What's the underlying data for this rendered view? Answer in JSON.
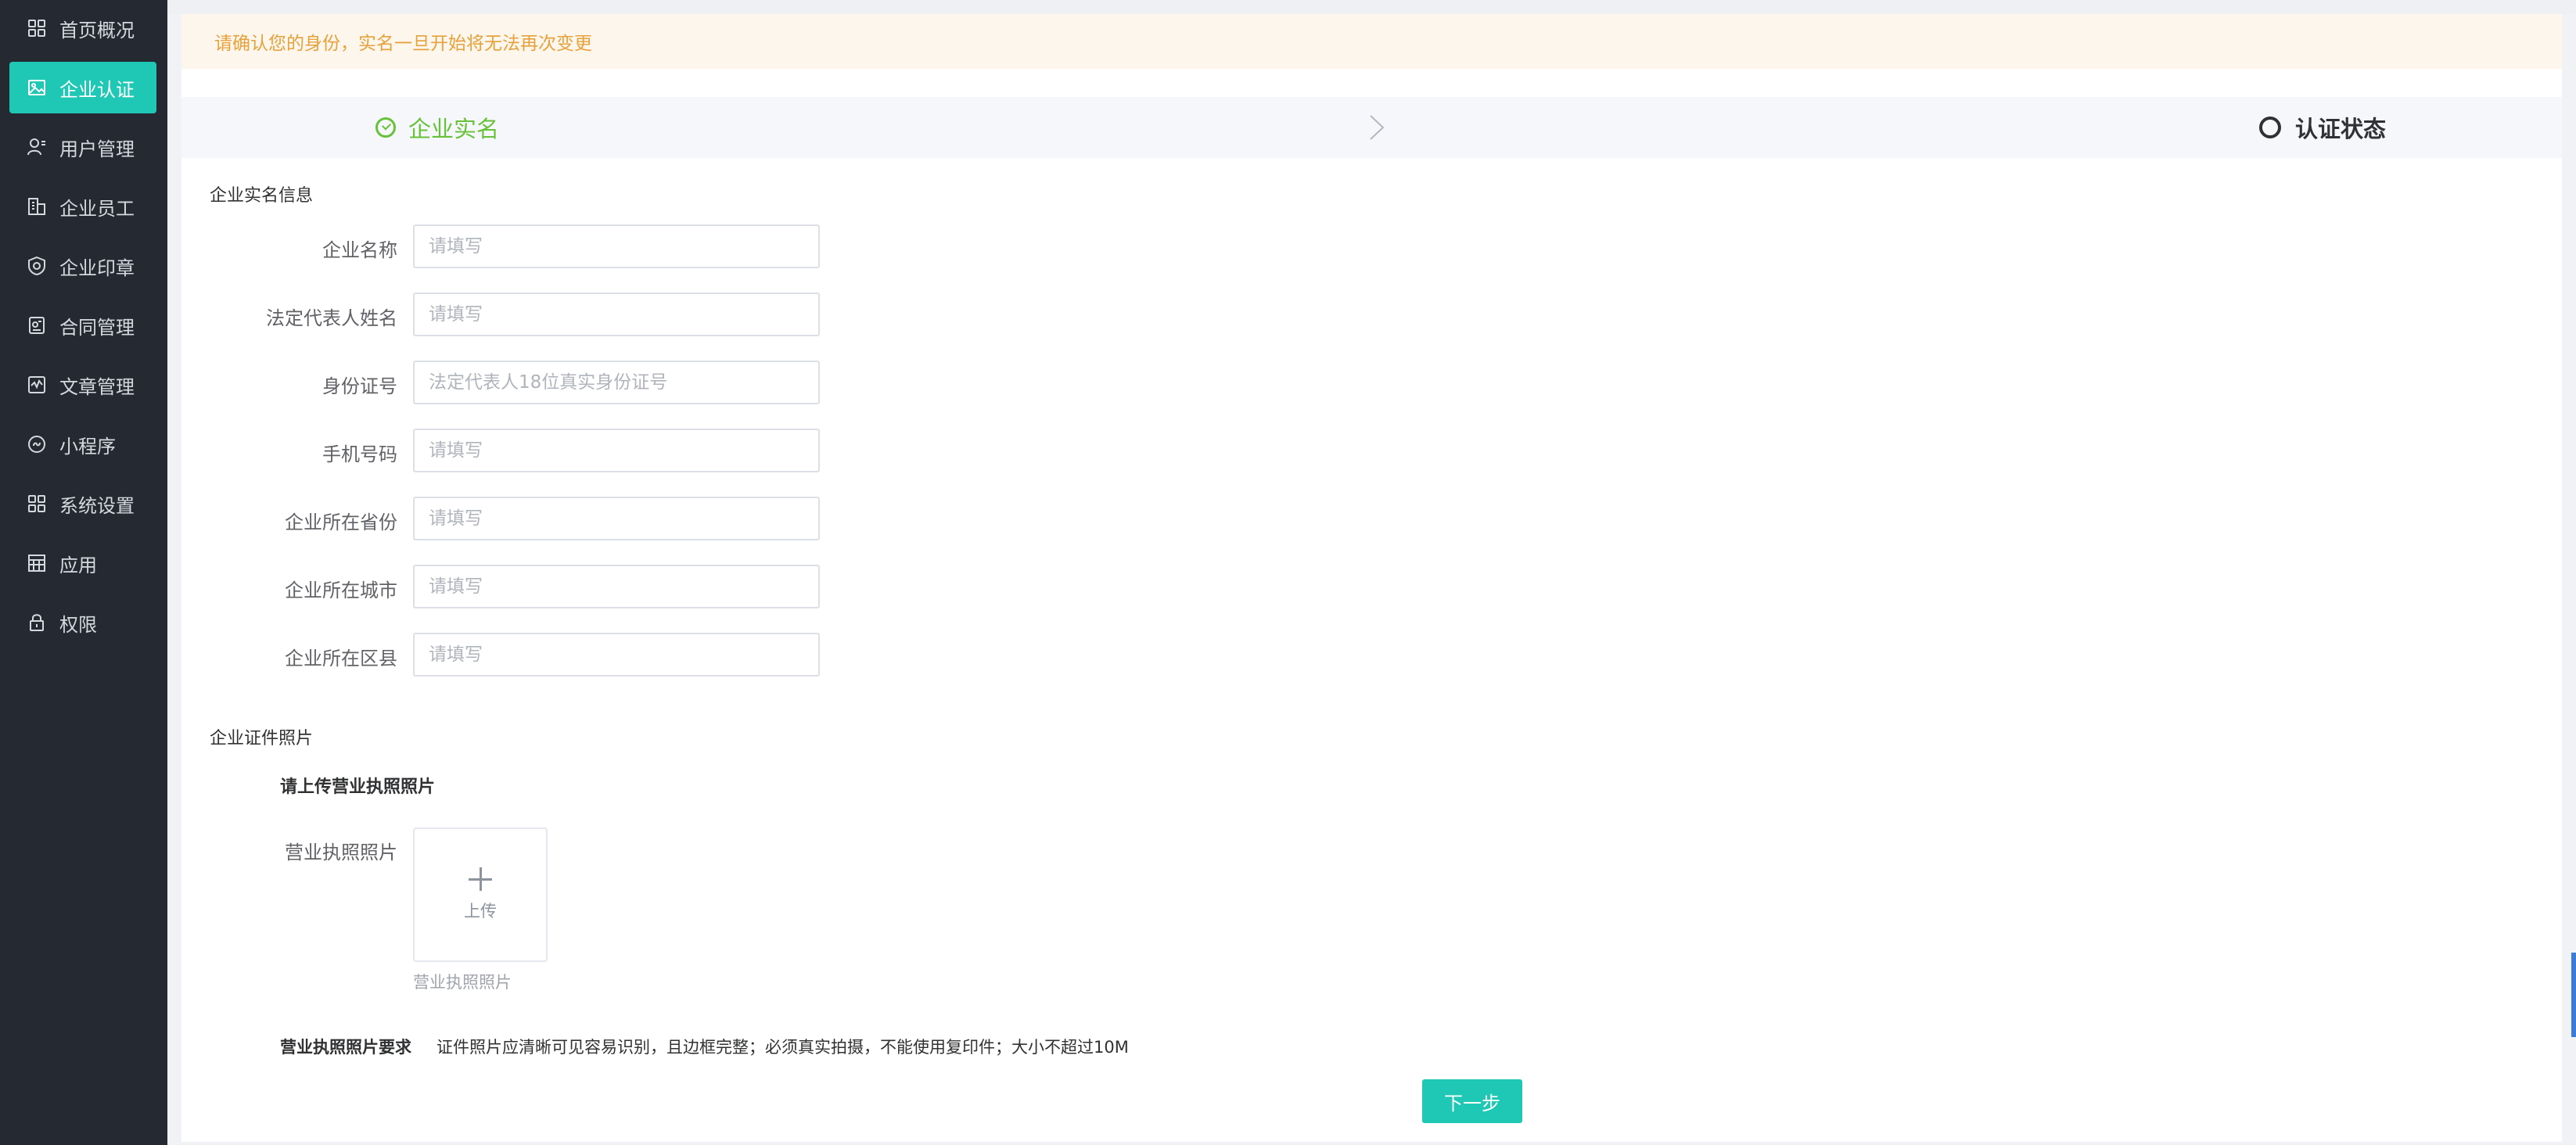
{
  "sidebar": {
    "items": [
      {
        "label": "首页概况",
        "icon": "dashboard-icon",
        "active": false
      },
      {
        "label": "企业认证",
        "icon": "image-icon",
        "active": true
      },
      {
        "label": "用户管理",
        "icon": "user-icon",
        "active": false
      },
      {
        "label": "企业员工",
        "icon": "building-icon",
        "active": false
      },
      {
        "label": "企业印章",
        "icon": "seal-icon",
        "active": false
      },
      {
        "label": "合同管理",
        "icon": "contract-icon",
        "active": false
      },
      {
        "label": "文章管理",
        "icon": "article-icon",
        "active": false
      },
      {
        "label": "小程序",
        "icon": "mini-program-icon",
        "active": false
      },
      {
        "label": "系统设置",
        "icon": "settings-grid-icon",
        "active": false
      },
      {
        "label": "应用",
        "icon": "apps-icon",
        "active": false
      },
      {
        "label": "权限",
        "icon": "lock-icon",
        "active": false
      }
    ]
  },
  "notice": {
    "text": "请确认您的身份，实名一旦开始将无法再次变更"
  },
  "steps": {
    "step1": {
      "label": "企业实名",
      "status": "done"
    },
    "step2": {
      "label": "认证状态",
      "status": "pending"
    }
  },
  "form": {
    "section_title": "企业实名信息",
    "fields": [
      {
        "label": "企业名称",
        "placeholder": "请填写",
        "value": ""
      },
      {
        "label": "法定代表人姓名",
        "placeholder": "请填写",
        "value": ""
      },
      {
        "label": "身份证号",
        "placeholder": "法定代表人18位真实身份证号",
        "value": ""
      },
      {
        "label": "手机号码",
        "placeholder": "请填写",
        "value": ""
      },
      {
        "label": "企业所在省份",
        "placeholder": "请填写",
        "value": ""
      },
      {
        "label": "企业所在城市",
        "placeholder": "请填写",
        "value": ""
      },
      {
        "label": "企业所在区县",
        "placeholder": "请填写",
        "value": ""
      }
    ]
  },
  "photos": {
    "section_title": "企业证件照片",
    "subtitle": "请上传营业执照照片",
    "field_label": "营业执照照片",
    "upload_text": "上传",
    "caption": "营业执照照片",
    "requirement_label": "营业执照照片要求",
    "requirement_text": "证件照片应清晰可见容易识别，且边框完整；必须真实拍摄，不能使用复印件；大小不超过10M"
  },
  "actions": {
    "next_label": "下一步"
  },
  "colors": {
    "sidebar_bg": "#252a32",
    "accent": "#1ec8b4",
    "success": "#67c23a",
    "warning_text": "#e6a23c",
    "warning_bg": "#fdf6ec"
  }
}
